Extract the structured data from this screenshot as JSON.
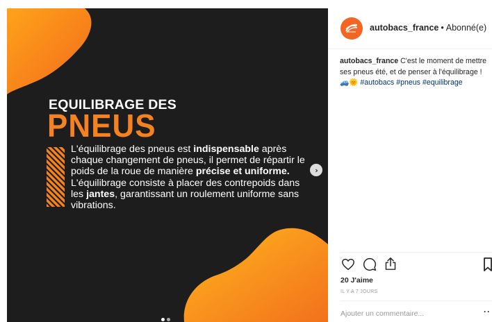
{
  "post": {
    "slide": {
      "heading_line1": "EQUILIBRAGE DES",
      "heading_line2": "PNEUS",
      "body": [
        {
          "text": "L'équilibrage des pneus est ",
          "bold": false
        },
        {
          "text": "indispensable",
          "bold": true
        },
        {
          "text": " après chaque changement de pneus, il permet de répartir le poids de la roue de manière ",
          "bold": false
        },
        {
          "text": "précise et uniforme.",
          "bold": true
        },
        {
          "text": " L'équilibrage consiste à placer des contrepoids dans les ",
          "bold": false
        },
        {
          "text": "jantes",
          "bold": true
        },
        {
          "text": ", garantissant un roulement uniforme sans vibrations.",
          "bold": false
        }
      ]
    },
    "carousel": {
      "next_icon": "chevron-right-icon",
      "dot_count": 2,
      "active_dot": 0
    }
  },
  "header": {
    "username": "autobacs_france",
    "separator": "•",
    "follow_status": "Abonné(e)"
  },
  "caption": {
    "username": "autobacs_france",
    "text": "C'est le moment de mettre ses pneus été, et de penser à l'équilibrage !",
    "emojis": "🚙🌞",
    "hashtags": [
      "#autobacs",
      "#pneus",
      "#equilibrage"
    ]
  },
  "actions": {
    "icons": [
      "heart-icon",
      "comment-icon",
      "share-icon",
      "bookmark-icon"
    ]
  },
  "likes": "20 J'aime",
  "timestamp": "IL Y A 7 JOURS",
  "comment": {
    "placeholder": "Ajouter un commentaire...",
    "more": "··"
  },
  "colors": {
    "brand_orange": "#f58220",
    "slide_background": "#1d1d1d",
    "hashtag": "#003569"
  }
}
